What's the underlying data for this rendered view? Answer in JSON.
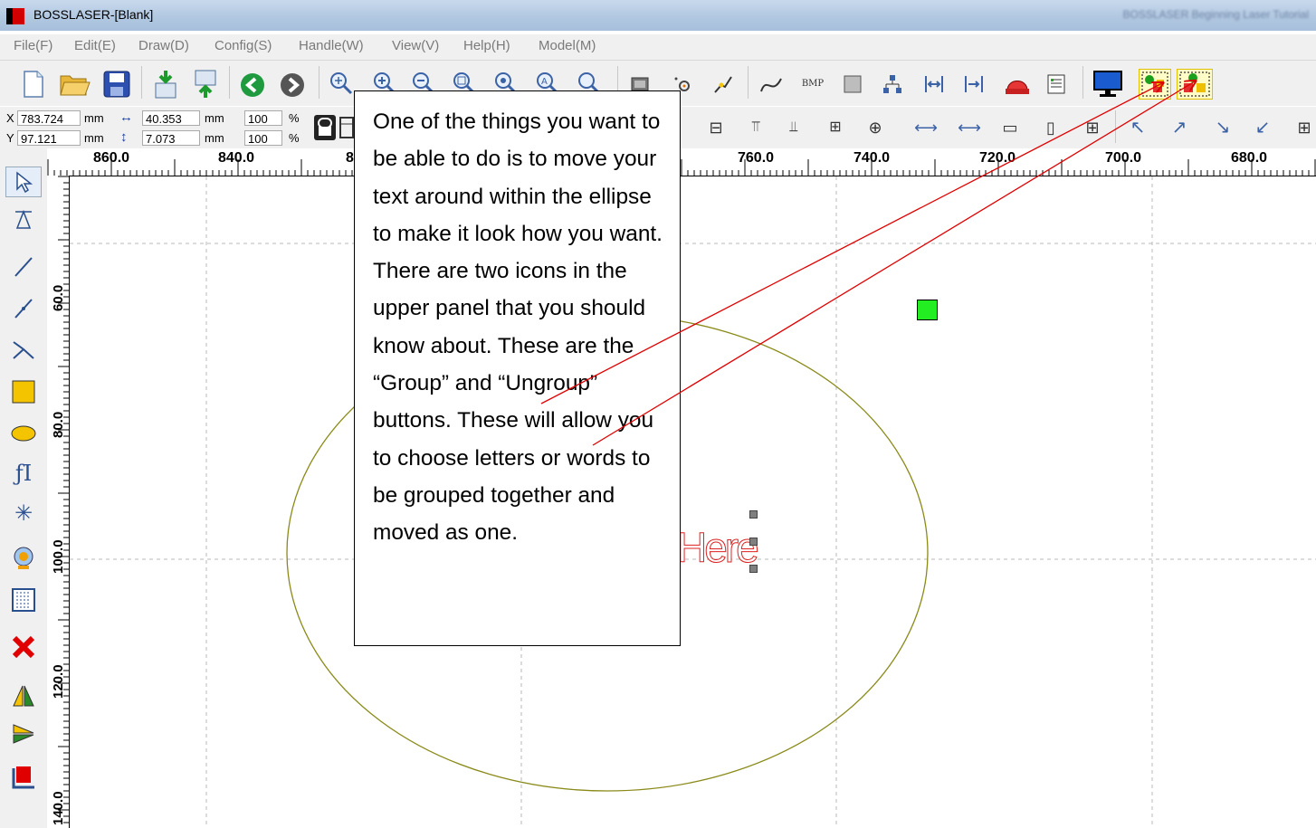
{
  "window": {
    "title": "BOSSLASER-[Blank]",
    "blurred_right_text": "BOSSLASER Beginning Laser Tutorial"
  },
  "menu": [
    "File(F)",
    "Edit(E)",
    "Draw(D)",
    "Config(S)",
    "Handle(W)",
    "View(V)",
    "Help(H)",
    "Model(M)"
  ],
  "toolbar": {
    "icons": [
      "new-file-icon",
      "open-folder-icon",
      "save-icon",
      "import-icon",
      "export-icon",
      "back-icon",
      "forward-icon",
      "zoom-in-icon",
      "zoom-plus-icon",
      "zoom-minus-icon",
      "zoom-fit-icon",
      "zoom-page-icon",
      "zoom-select-icon",
      "zoom-all-icon",
      "rectangle-select-icon",
      "node-icon",
      "pen-icon",
      "curve-icon",
      "bmp-icon",
      "gray-box-icon",
      "group-tree-icon",
      "align-h-icon",
      "align-right-icon",
      "laser-icon",
      "grid-icon",
      "monitor-icon",
      "group-icon",
      "ungroup-icon"
    ],
    "bmp_label": "BMP"
  },
  "properties": {
    "x_label": "X",
    "x_value": "783.724",
    "x_unit": "mm",
    "y_label": "Y",
    "y_value": "97.121",
    "y_unit": "mm",
    "width_value": "40.353",
    "width_unit": "mm",
    "height_value": "7.073",
    "height_unit": "mm",
    "scale_x": "100",
    "scale_y": "100",
    "percent": "%"
  },
  "ruler": {
    "top_labels": [
      "860.0",
      "840.0",
      "8",
      "760.0",
      "740.0",
      "720.0",
      "700.0",
      "680.0"
    ],
    "left_labels": [
      "60.0",
      "80.0",
      "100.0",
      "120.0",
      "140.0"
    ]
  },
  "canvas": {
    "text_object": "Here",
    "callout_text": "One of the things you want to be able to do is to move your text around within the ellipse to make it look how you want. There are two icons in the upper panel that you should know about.  These are the “Group” and “Ungroup” buttons.  These will allow you to choose letters or words to be grouped together and moved as one."
  },
  "colors": {
    "arrow": "#e00000",
    "ellipse": "#8a8a1a",
    "selection": "#22ee22",
    "text_outline": "#d22222"
  }
}
